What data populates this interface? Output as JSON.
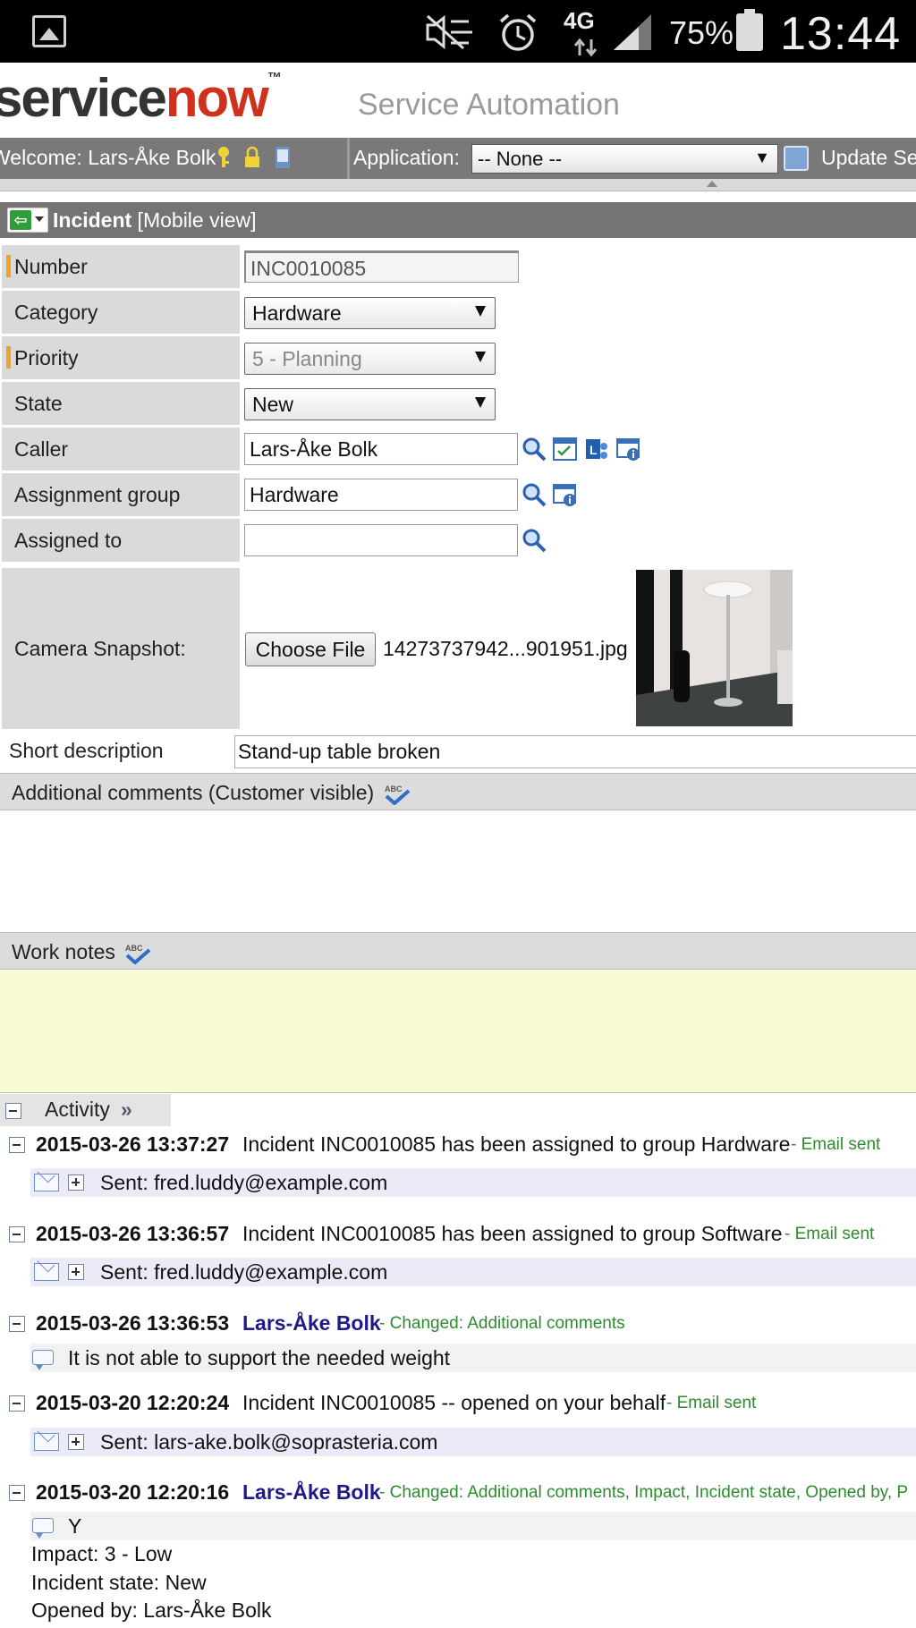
{
  "status_bar": {
    "network": "4G",
    "battery_percent": "75%",
    "time": "13:44",
    "icons": [
      "gallery-icon",
      "mute-icon",
      "alarm-icon",
      "network-4g-icon",
      "signal-icon",
      "battery-icon"
    ]
  },
  "header": {
    "logo_service": "service",
    "logo_now": "now",
    "logo_tm": "™",
    "tagline": "Service Automation",
    "brand_color": "#d0311d"
  },
  "welcome_bar": {
    "welcome_text": "Welcome:  Lars-Åke Bolk",
    "application_label": "Application:",
    "application_value": "-- None --",
    "update_label": "Update Set"
  },
  "form": {
    "title_bold": "Incident",
    "title_suffix": " [Mobile view]",
    "fields": {
      "number": {
        "label": "Number",
        "value": "INC0010085"
      },
      "category": {
        "label": "Category",
        "value": "Hardware"
      },
      "priority": {
        "label": "Priority",
        "value": "5 - Planning"
      },
      "state": {
        "label": "State",
        "value": "New"
      },
      "caller": {
        "label": "Caller",
        "value": "Lars-Åke Bolk"
      },
      "assignment_group": {
        "label": "Assignment group",
        "value": "Hardware"
      },
      "assigned_to": {
        "label": "Assigned to",
        "value": ""
      },
      "camera_snapshot": {
        "label": "Camera Snapshot:",
        "button": "Choose File",
        "filename": "14273737942...901951.jpg"
      },
      "short_description": {
        "label": "Short description",
        "value": "Stand-up table broken"
      }
    },
    "additional_comments_label": "Additional comments (Customer visible)",
    "work_notes_label": "Work notes"
  },
  "activity": {
    "label": "Activity",
    "entries": [
      {
        "timestamp": "2015-03-26 13:37:27",
        "message": "Incident INC0010085 has been assigned to group Hardware",
        "tag": "- Email sent",
        "sent": "Sent: fred.luddy@example.com"
      },
      {
        "timestamp": "2015-03-26 13:36:57",
        "message": "Incident INC0010085 has been assigned to group Software",
        "tag": "- Email sent",
        "sent": "Sent: fred.luddy@example.com"
      },
      {
        "timestamp": "2015-03-26 13:36:53",
        "user": "Lars-Åke Bolk",
        "tag": "- Changed:  Additional comments",
        "comment": "It is not able to support the needed weight"
      },
      {
        "timestamp": "2015-03-20 12:20:24",
        "message": "Incident INC0010085 -- opened on your behalf",
        "tag": "- Email sent",
        "sent": "Sent: lars-ake.bolk@soprasteria.com"
      },
      {
        "timestamp": "2015-03-20 12:20:16",
        "user": "Lars-Åke Bolk",
        "tag": "- Changed:  Additional comments, Impact, Incident state, Opened by, P",
        "comment": "Y",
        "lines": [
          "Impact: 3 - Low",
          "Incident state: New",
          "Opened by: Lars-Åke Bolk"
        ]
      }
    ]
  }
}
